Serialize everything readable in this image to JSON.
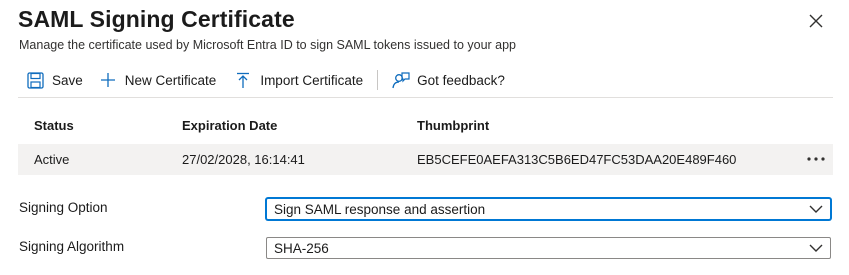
{
  "panel": {
    "title": "SAML Signing Certificate",
    "subtitle": "Manage the certificate used by Microsoft Entra ID to sign SAML tokens issued to your app"
  },
  "toolbar": {
    "save_label": "Save",
    "new_cert_label": "New Certificate",
    "import_cert_label": "Import Certificate",
    "feedback_label": "Got feedback?",
    "icons": [
      "save-icon",
      "add-icon",
      "upload-icon",
      "feedback-icon"
    ]
  },
  "grid": {
    "columns": [
      "Status",
      "Expiration Date",
      "Thumbprint"
    ],
    "rows": [
      {
        "status": "Active",
        "expiration": "27/02/2028, 16:14:41",
        "thumbprint": "EB5CEFE0AEFA313C5B6ED47FC53DAA20E489F460"
      }
    ]
  },
  "signing_option": {
    "label": "Signing Option",
    "value": "Sign SAML response and assertion"
  },
  "signing_algorithm": {
    "label": "Signing Algorithm",
    "value": "SHA-256"
  },
  "colors": {
    "accent": "#0078d4",
    "icon": "#0f6cbd",
    "row_background": "#f3f2f1"
  }
}
